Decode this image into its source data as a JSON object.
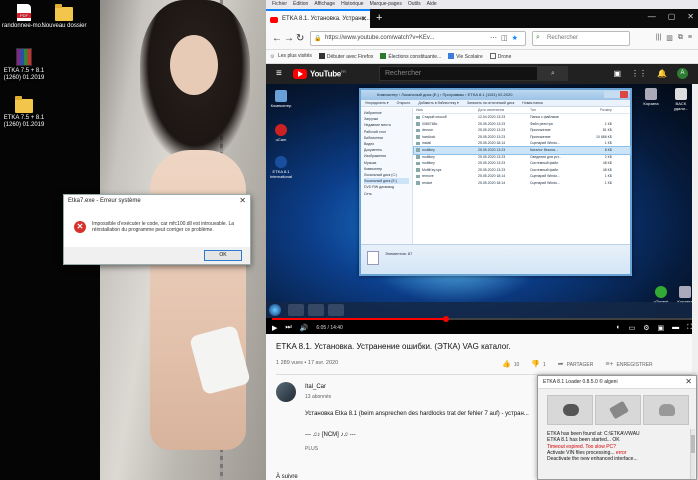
{
  "desktop": {
    "icons": [
      {
        "label": "randonnee-mo...",
        "icon": "pdf-file-icon"
      },
      {
        "label": "Nouveau dossier",
        "icon": "folder-icon"
      },
      {
        "label": "ETKA 7.5 + 8.1 (1260) 01.2019",
        "icon": "winrar-archive-icon"
      },
      {
        "label": "ETKA 7.5 + 8.1 (1260) 01.2019",
        "icon": "folder-icon"
      }
    ]
  },
  "error_dialog": {
    "title": "Etka7.exe - Erreur système",
    "message": "Impossible d’exécuter le code, car mfc100.dll est introuvable. La réinstallation du programme peut corriger ce problème.",
    "ok_label": "OK"
  },
  "browser": {
    "menu": [
      "Fichier",
      "Édition",
      "Affichage",
      "Historique",
      "Marque-pages",
      "Outils",
      "Aide"
    ],
    "tab_title": "ETKA 8.1. Установка. Устране...",
    "url": "https://www.youtube.com/watch?v=KEv...",
    "search_placeholder": "Rechercher",
    "bookmarks": [
      "Les plus visités",
      "Débuter avec Firefox",
      "Élections constituante...",
      "Vie Scolaire",
      "Drone"
    ]
  },
  "youtube": {
    "logo_text": "YouTube",
    "logo_region": "FR",
    "search_placeholder": "Rechercher",
    "avatar_letter": "A",
    "video": {
      "time_current": "6:05",
      "time_total": "14:40",
      "progress": 0.415,
      "taskbar_text": "Элементов: 87"
    },
    "title": "ETKA 8.1. Установка. Устранение ошибки. (ЭТКА) VAG каталог.",
    "meta": "1 289 vues • 17 avr. 2020",
    "likes": "10",
    "dislikes": "1",
    "share_label": "PARTAGER",
    "save_label": "ENREGISTRER",
    "channel_name": "Ital_Car",
    "channel_subs": "13 abonnés",
    "description": "Установка Etka 8.1 (beim ansprechen des hardlocks trat der fehler 7 auf) - устран...",
    "description_line2": "--- ♫♪ [NCM] ♪♫ ---",
    "more_label": "PLUS",
    "followup": "À suivre"
  },
  "video_explorer": {
    "title": "Компьютер › Локальный диск (E:) › Программы › ETKA 8.1 (1151) 02.2020",
    "toolbar": [
      "Упорядочить ▾",
      "Открыть",
      "Добавить в библиотеку ▾",
      "Записать на оптический диск",
      "Новая папка"
    ],
    "sidebar": [
      "Избранное",
      "Загрузки",
      "Недавние места",
      "Рабочий стол",
      "",
      "Библиотеки",
      "Видео",
      "Документы",
      "Изображения",
      "Музыка",
      "",
      "Компьютер",
      "Локальный диск (C:)",
      "Локальный диск (E:)",
      "DVD RW дисковод",
      "",
      "Сеть"
    ],
    "columns": [
      "Имя",
      "Дата изменения",
      "Тип",
      "Размер"
    ],
    "rows": [
      {
        "name": "Старый способ",
        "date": "12.04.2020 13:23",
        "type": "Папка с файлами",
        "size": ""
      },
      {
        "name": "0080768c",
        "date": "25.05.2020 13:23",
        "type": "Файл реестра",
        "size": "1 КБ"
      },
      {
        "name": "devcon",
        "date": "25.05.2020 13:23",
        "type": "Приложение",
        "size": "81 КБ"
      },
      {
        "name": "hardlock",
        "date": "25.05.2020 13:23",
        "type": "Приложение",
        "size": "10 686 КБ"
      },
      {
        "name": "install",
        "date": "25.05.2020 18:14",
        "type": "Сценарий Windo...",
        "size": "1 КБ"
      },
      {
        "name": "multikey",
        "date": "25.05.2020 13:23",
        "type": "Каталог безопа...",
        "size": "8 КБ"
      },
      {
        "name": "multikey",
        "date": "25.05.2020 13:23",
        "type": "Сведения для уст...",
        "size": "2 КБ"
      },
      {
        "name": "multikey",
        "date": "25.05.2020 13:23",
        "type": "Системный файл",
        "size": "48 КБ"
      },
      {
        "name": "MultiKey.sys",
        "date": "25.05.2020 13:23",
        "type": "Системный файл",
        "size": "48 КБ"
      },
      {
        "name": "remove",
        "date": "25.05.2020 18:14",
        "type": "Сценарий Windo...",
        "size": "1 КБ"
      },
      {
        "name": "restart",
        "date": "25.05.2020 18:14",
        "type": "Сценарий Windo...",
        "size": "1 КБ"
      }
    ],
    "status": "Элементов: 87",
    "desktop_icons": [
      "Компьютер",
      "uCam",
      "ETKA 8.1 International",
      "Корзина",
      "BACK удали...",
      "µTorrent",
      "Корзина"
    ]
  },
  "loader": {
    "title": "ETKA 8.1 Loader 0.8.5.0 © algeni",
    "log": [
      {
        "text": "ETKA has been found at: C:\\ETKA\\VWAU",
        "error": false
      },
      {
        "text": "ETKA 8.1 has been started... OK",
        "error": false
      },
      {
        "text": "Timeout expired. Too slow PC?",
        "error": true
      },
      {
        "text": "Activate VIN files processing... ",
        "error": false,
        "suffix": "error"
      },
      {
        "text": "Deactivate the new enhanced interface...",
        "error": false
      }
    ]
  }
}
